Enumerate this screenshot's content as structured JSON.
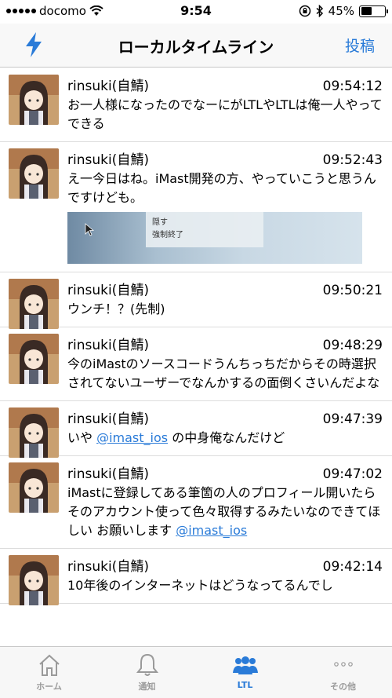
{
  "status_bar": {
    "carrier": "docomo",
    "time": "9:54",
    "battery": "45%",
    "battery_level": 0.45
  },
  "nav": {
    "title": "ローカルタイムライン",
    "left_icon": "lightning-icon",
    "right_label": "投稿"
  },
  "colors": {
    "accent": "#2a7bd8",
    "inactive": "#9a9a9a"
  },
  "posts": [
    {
      "author": "rinsuki(自鯖)",
      "time": "09:54:12",
      "body": "お一人様になったのでなーにがLTLやLTLは俺一人やってできる"
    },
    {
      "author": "rinsuki(自鯖)",
      "time": "09:52:43",
      "body": "え一今日はね。iMast開発の方、やっていこうと思うんですけども。",
      "media": {
        "line1": "隠す",
        "line2": "強制終了"
      }
    },
    {
      "author": "rinsuki(自鯖)",
      "time": "09:50:21",
      "body": "ウンチ！？(先制)"
    },
    {
      "author": "rinsuki(自鯖)",
      "time": "09:48:29",
      "body": "今のiMastのソースコードうんちっちだからその時選択されてないユーザーでなんかするの面倒くさいんだよな"
    },
    {
      "author": "rinsuki(自鯖)",
      "time": "09:47:39",
      "body_pre": "いや ",
      "mention": "@imast_ios",
      "body_post": " の中身俺なんだけど"
    },
    {
      "author": "rinsuki(自鯖)",
      "time": "09:47:02",
      "body_pre": "iMastに登録してある筆箇の人のプロフィール開いたらそのアカウント使って色々取得するみたいなのできてほしい お願いします ",
      "mention": "@imast_ios",
      "body_post": ""
    },
    {
      "author": "rinsuki(自鯖)",
      "time": "09:42:14",
      "body": "10年後のインターネットはどうなってるんでし"
    }
  ],
  "tabs": [
    {
      "label": "ホーム",
      "icon": "home-icon",
      "active": false
    },
    {
      "label": "通知",
      "icon": "bell-icon",
      "active": false
    },
    {
      "label": "LTL",
      "icon": "users-icon",
      "active": true
    },
    {
      "label": "その他",
      "icon": "more-icon",
      "active": false
    }
  ]
}
